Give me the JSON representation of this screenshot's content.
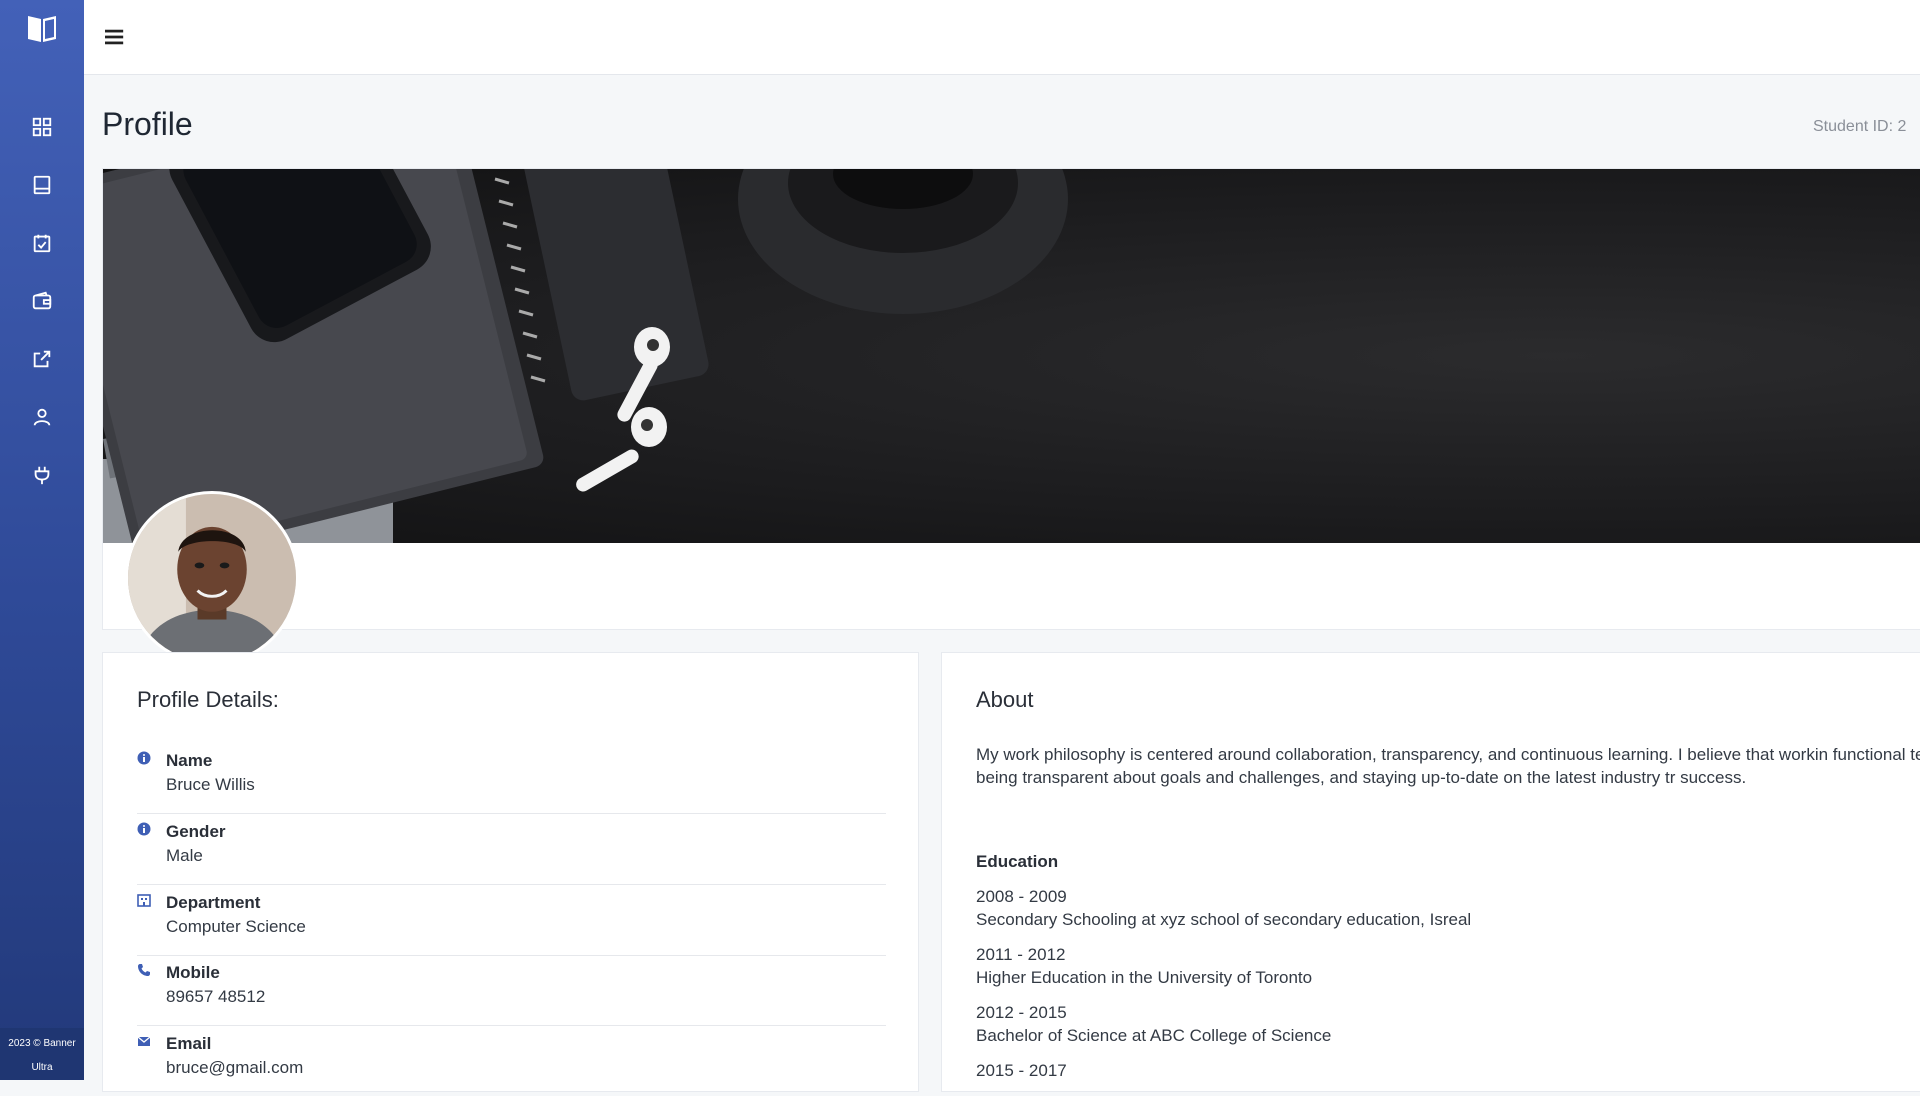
{
  "sidebar": {
    "footer_line1": "2023 © Banner",
    "footer_line2": "Ultra",
    "items": [
      {
        "icon": "dashboard-grid-icon"
      },
      {
        "icon": "book-icon"
      },
      {
        "icon": "calendar-check-icon"
      },
      {
        "icon": "wallet-icon"
      },
      {
        "icon": "external-link-icon"
      },
      {
        "icon": "user-icon"
      },
      {
        "icon": "plug-icon"
      }
    ],
    "logo_icon": "open-book-logo-icon"
  },
  "topbar": {
    "menu_icon": "hamburger-menu-icon"
  },
  "page": {
    "title": "Profile",
    "student_id": "Student ID: 2"
  },
  "profile_details": {
    "title": "Profile Details:",
    "fields": [
      {
        "label": "Name",
        "value": "Bruce Willis",
        "icon": "info-circle-icon"
      },
      {
        "label": "Gender",
        "value": "Male",
        "icon": "info-circle-icon"
      },
      {
        "label": "Department",
        "value": "Computer Science",
        "icon": "building-icon"
      },
      {
        "label": "Mobile",
        "value": "89657 48512",
        "icon": "phone-icon"
      },
      {
        "label": "Email",
        "value": "bruce@gmail.com",
        "icon": "envelope-icon"
      }
    ]
  },
  "about": {
    "title": "About",
    "text": "My work philosophy is centered around collaboration, transparency, and continuous learning. I believe that workin functional teams, being transparent about goals and challenges, and staying up-to-date on the latest industry tr success.",
    "education_title": "Education",
    "education": [
      {
        "years": "2008 - 2009",
        "detail": "Secondary Schooling at xyz school of secondary education, Isreal"
      },
      {
        "years": "2011 - 2012",
        "detail": "Higher Education in the University of Toronto"
      },
      {
        "years": "2012 - 2015",
        "detail": "Bachelor of Science at ABC College of Science"
      },
      {
        "years": "2015 - 2017",
        "detail": ""
      }
    ]
  },
  "colors": {
    "sidebar_top": "#4361b8",
    "sidebar_bottom": "#22397a",
    "accent_icon": "#3f5fb5"
  }
}
